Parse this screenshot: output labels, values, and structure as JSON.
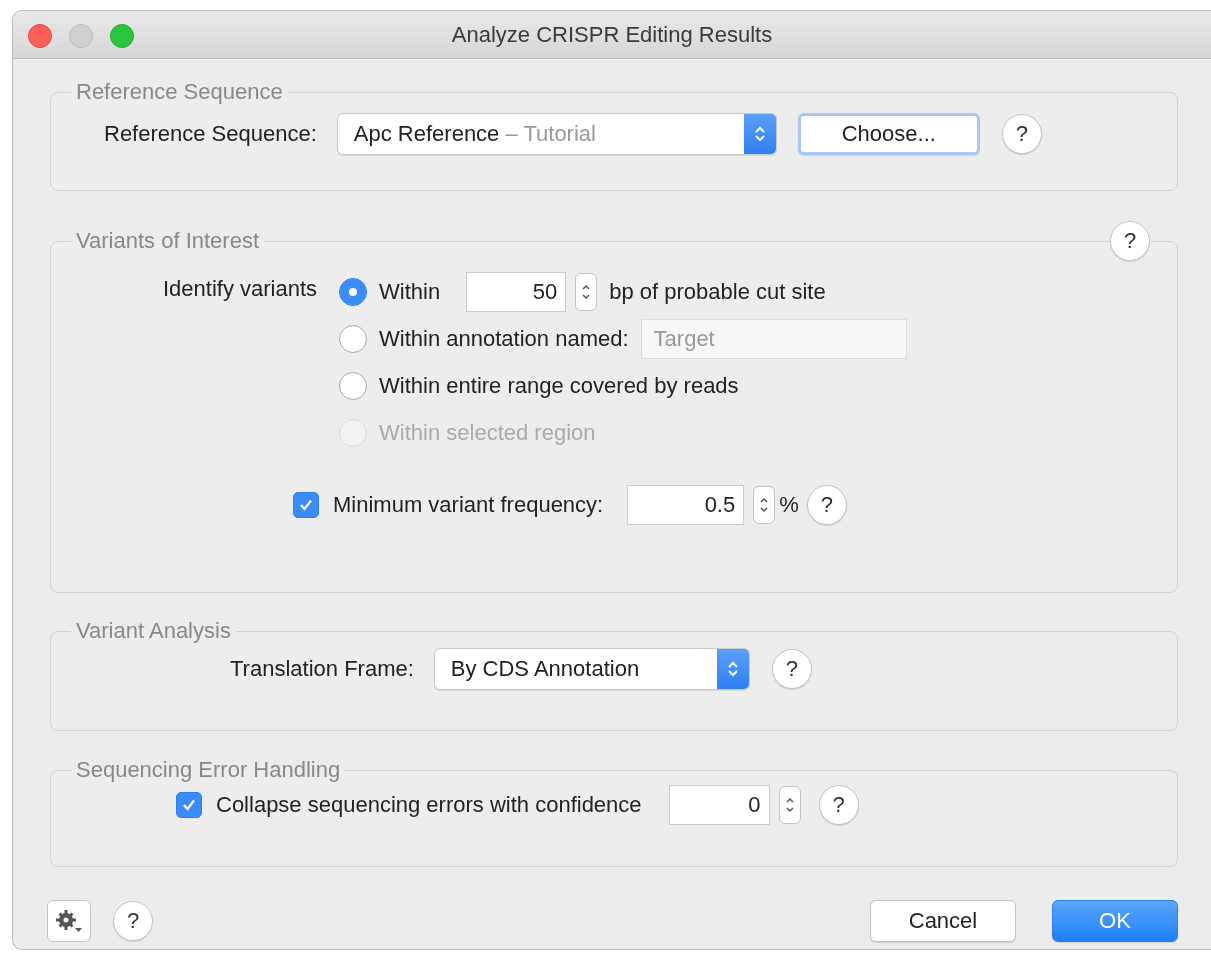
{
  "window": {
    "title": "Analyze CRISPR Editing Results"
  },
  "reference_sequence": {
    "legend": "Reference Sequence",
    "label": "Reference Sequence:",
    "select": {
      "value": "Apc Reference",
      "suffix": "– Tutorial"
    },
    "choose_button": "Choose...",
    "help": "?"
  },
  "variants_of_interest": {
    "legend": "Variants of Interest",
    "help": "?",
    "label": "Identify variants",
    "options": [
      {
        "kind": "window",
        "label": "Within",
        "selected": true,
        "disabled": false,
        "value": "50",
        "suffix": "bp of probable cut site"
      },
      {
        "kind": "annotation",
        "label": "Within annotation named:",
        "selected": false,
        "disabled": false,
        "placeholder": "Target"
      },
      {
        "kind": "plain",
        "label": "Within entire range covered by reads",
        "selected": false,
        "disabled": false
      },
      {
        "kind": "plain",
        "label": "Within selected region",
        "selected": false,
        "disabled": true
      }
    ],
    "min_frequency": {
      "checked": true,
      "label": "Minimum variant frequency:",
      "value": "0.5",
      "unit": "%",
      "help": "?"
    }
  },
  "variant_analysis": {
    "legend": "Variant Analysis",
    "label": "Translation Frame:",
    "select": "By CDS Annotation",
    "help": "?"
  },
  "sequencing_error_handling": {
    "legend": "Sequencing Error Handling",
    "checked": true,
    "label": "Collapse sequencing errors with confidence",
    "value": "0",
    "help": "?"
  },
  "footer": {
    "help": "?",
    "buttons": [
      {
        "label": "Cancel",
        "kind": "cancel"
      },
      {
        "label": "OK",
        "kind": "default"
      }
    ]
  }
}
